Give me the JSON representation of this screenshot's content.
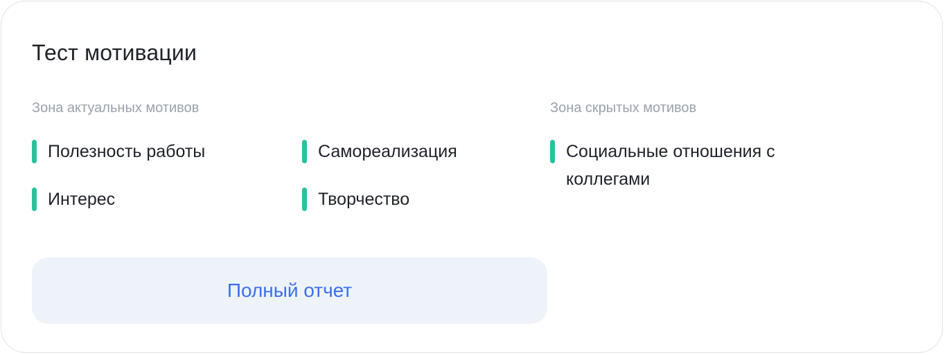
{
  "card": {
    "title": "Тест мотивации"
  },
  "zones": {
    "actual": {
      "title": "Зона актуальных мотивов",
      "items": [
        {
          "label": "Полезность работы"
        },
        {
          "label": "Самореализация"
        },
        {
          "label": "Интерес"
        },
        {
          "label": "Творчество"
        }
      ]
    },
    "hidden": {
      "title": "Зона скрытых мотивов",
      "items": [
        {
          "label": "Социальные отношения с коллегами"
        }
      ]
    }
  },
  "actions": {
    "report_label": "Полный отчет"
  },
  "colors": {
    "accent_bar": "#28c39b",
    "button_text": "#3a6ff0",
    "button_bg": "#eef3fa"
  }
}
